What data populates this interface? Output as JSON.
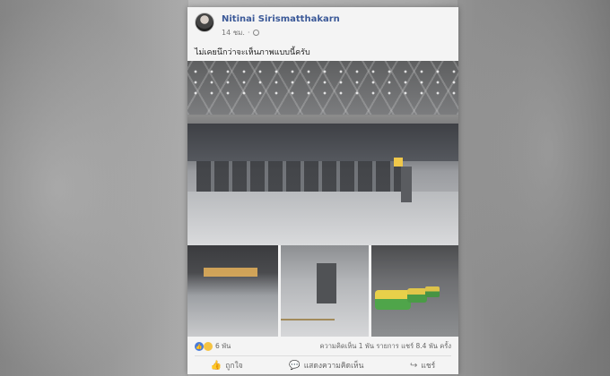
{
  "post": {
    "author": "Nitinai Sirismatthakarn",
    "time": "14 ชม.",
    "caption": "ไม่เคยนึกว่าจะเห็นภาพแบบนี้ครับ",
    "reactions_count": "6 พัน",
    "comments_shares": "ความคิดเห็น 1 พัน รายการ  แชร์ 8.4 พัน ครั้ง"
  },
  "actions": {
    "like_label": "ถูกใจ",
    "comment_label": "แสดงความคิดเห็น",
    "share_label": "แชร์"
  },
  "icons": {
    "like": "thumbs-up-icon",
    "comment": "comment-icon",
    "share": "share-arrow-icon",
    "privacy": "globe-icon"
  },
  "colors": {
    "author_link": "#3b5998",
    "like_reaction": "#4a7bd8"
  }
}
